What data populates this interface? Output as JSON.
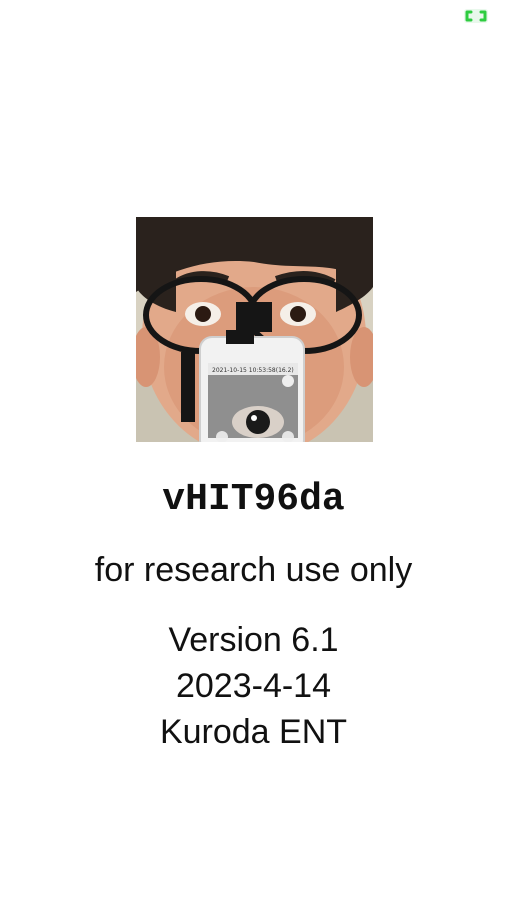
{
  "status": {
    "indicator_icon": "green-corner-bracket-icon",
    "indicator_color": "#2ecc40"
  },
  "splash": {
    "image_icon": "person-wearing-goggles-with-phone-photo",
    "phone_screen_text": "2021-10-15 10:53:58(16.2)"
  },
  "app": {
    "title": "vHIT96da",
    "tagline": "for research use only",
    "version": "Version 6.1",
    "date": "2023-4-14",
    "author": "Kuroda ENT"
  }
}
